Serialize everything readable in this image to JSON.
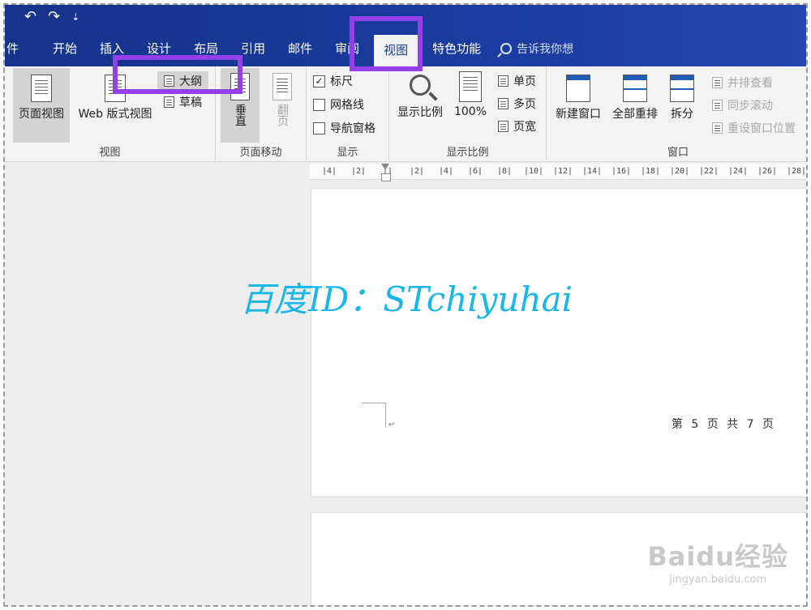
{
  "qat": {
    "undo": "↶",
    "redo": "↷",
    "more": "⇣"
  },
  "tabs": [
    {
      "label": "件",
      "name": "tab-file"
    },
    {
      "label": "开始",
      "name": "tab-home"
    },
    {
      "label": "插入",
      "name": "tab-insert"
    },
    {
      "label": "设计",
      "name": "tab-design"
    },
    {
      "label": "布局",
      "name": "tab-layout"
    },
    {
      "label": "引用",
      "name": "tab-references"
    },
    {
      "label": "邮件",
      "name": "tab-mailings"
    },
    {
      "label": "审阅",
      "name": "tab-review"
    },
    {
      "label": "视图",
      "name": "tab-view"
    },
    {
      "label": "特色功能",
      "name": "tab-features"
    }
  ],
  "tellme": "告诉我你想",
  "ribbon": {
    "views": {
      "label": "视图",
      "print_layout": "页面视图",
      "web_layout": "Web 版式视图",
      "outline": "大纲",
      "draft": "草稿"
    },
    "page_movement": {
      "label": "页面移动",
      "vertical": "垂直",
      "side_to_side": "翻页"
    },
    "show": {
      "label": "显示",
      "ruler": "标尺",
      "ruler_checked": true,
      "gridlines": "网格线",
      "nav_pane": "导航窗格"
    },
    "zoom": {
      "label": "显示比例",
      "zoom": "显示比例",
      "hundred": "100%",
      "one_page": "单页",
      "multi_page": "多页",
      "page_width": "页宽"
    },
    "window": {
      "label": "窗口",
      "new_window": "新建窗口",
      "arrange_all": "全部重排",
      "split": "拆分",
      "side_by_side": "并排查看",
      "sync_scroll": "同步滚动",
      "reset_pos": "重设窗口位置"
    }
  },
  "ruler_ticks": [
    "4",
    "2",
    "",
    "2",
    "4",
    "6",
    "8",
    "10",
    "12",
    "14",
    "16",
    "18",
    "20",
    "22",
    "24",
    "26",
    "28"
  ],
  "document": {
    "footer": "第 5 页 共 7 页",
    "para_mark": "↵"
  },
  "watermark": "百度ID：STchiyuhai",
  "baidu": {
    "logo": "Baidu经验",
    "url": "jingyan.baidu.com"
  },
  "colors": {
    "accent": "#1a3ca0",
    "highlight": "#9340ea",
    "watermark": "#18b7e8"
  }
}
